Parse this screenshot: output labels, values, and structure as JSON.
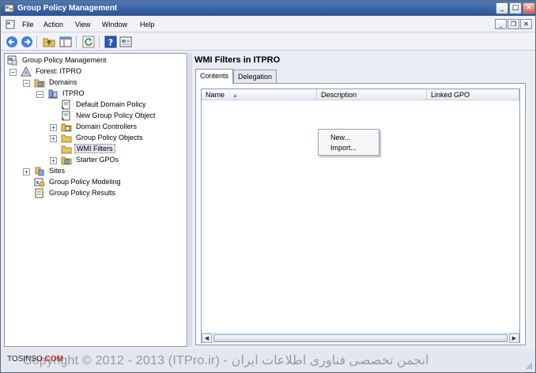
{
  "window": {
    "title": "Group Policy Management",
    "controls": {
      "minimize": "_",
      "maximize": "□",
      "close": "✕"
    }
  },
  "menu": {
    "items": [
      "File",
      "Action",
      "View",
      "Window",
      "Help"
    ],
    "mdi_controls": {
      "minimize": "_",
      "restore": "❐",
      "close": "✕"
    }
  },
  "toolbar": {
    "icons": [
      "back-arrow-icon",
      "forward-arrow-icon",
      "up-folder-icon",
      "show-hide-tree-icon",
      "refresh-icon",
      "help-icon",
      "properties-icon"
    ]
  },
  "tree": {
    "root": "Group Policy Management",
    "forest": "Forest: ITPRO",
    "domains": "Domains",
    "domain": "ITPRO",
    "default_domain_policy": "Default Domain Policy",
    "new_gpo": "New Group Policy Object",
    "domain_controllers": "Domain Controllers",
    "gpo_container": "Group Policy Objects",
    "wmi_filters": "WMI Filters",
    "starter_gpos": "Starter GPOs",
    "sites": "Sites",
    "modeling": "Group Policy Modeling",
    "results": "Group Policy Results",
    "expander_plus": "+",
    "expander_minus": "−"
  },
  "right": {
    "title": "WMI Filters in ITPRO",
    "tabs": [
      "Contents",
      "Delegation"
    ],
    "columns": [
      "Name",
      "Description",
      "Linked GPO"
    ],
    "sort_arrow": "▲",
    "scroll_left": "◀",
    "scroll_right": "▶"
  },
  "context_menu": {
    "items": [
      "New...",
      "Import..."
    ]
  },
  "status": {
    "watermark": "Copyright © 2012 - 2013 (ITPro.ir) - انجمن تخصصی فناوری اطلاعات ایران",
    "brand_prefix": "TOSINSO",
    "brand_suffix": ".COM"
  },
  "colors": {
    "titlebar": "#2a5497",
    "folder": "#e6c25a",
    "selection": "#dfe4ec"
  }
}
